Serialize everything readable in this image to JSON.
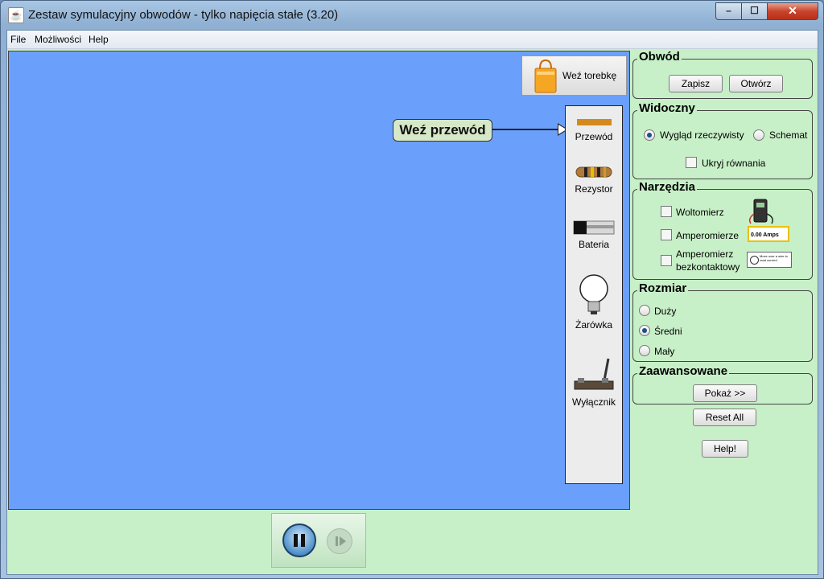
{
  "window": {
    "title": "Zestaw symulacyjny obwodów - tylko napięcia stałe (3.20)",
    "controls": {
      "minimize": "–",
      "maximize": "☐",
      "close": "✕"
    }
  },
  "menu": {
    "file": "File",
    "options": "Możliwości",
    "help": "Help"
  },
  "canvas": {
    "bag_button": "Weź torebkę",
    "callout": "Weź przewód",
    "toolbox": {
      "wire": "Przewód",
      "resistor": "Rezystor",
      "battery": "Bateria",
      "bulb": "Żarówka",
      "switch": "Wyłącznik"
    }
  },
  "panel": {
    "circuit": {
      "title": "Obwód",
      "save": "Zapisz",
      "open": "Otwórz"
    },
    "visual": {
      "title": "Widoczny",
      "realistic": "Wygląd rzeczywisty",
      "schematic": "Schemat",
      "selected": "realistic",
      "hide_equations": "Ukryj równania"
    },
    "tools": {
      "title": "Narzędzia",
      "voltmeter": "Woltomierz",
      "ammeter": "Amperomierze",
      "ammeter_reading": "0.00 Amps",
      "noncontact_1": "Amperomierz",
      "noncontact_2": "bezkontaktowy",
      "noncontact_hint": "Move over a wire to read current."
    },
    "size": {
      "title": "Rozmiar",
      "large": "Duży",
      "medium": "Średni",
      "small": "Mały",
      "selected": "medium"
    },
    "advanced": {
      "title": "Zaawansowane",
      "show": "Pokaż >>"
    },
    "reset": "Reset All",
    "help": "Help!"
  },
  "colors": {
    "canvas": "#6aa0fb",
    "panel": "#c8f0c8"
  }
}
